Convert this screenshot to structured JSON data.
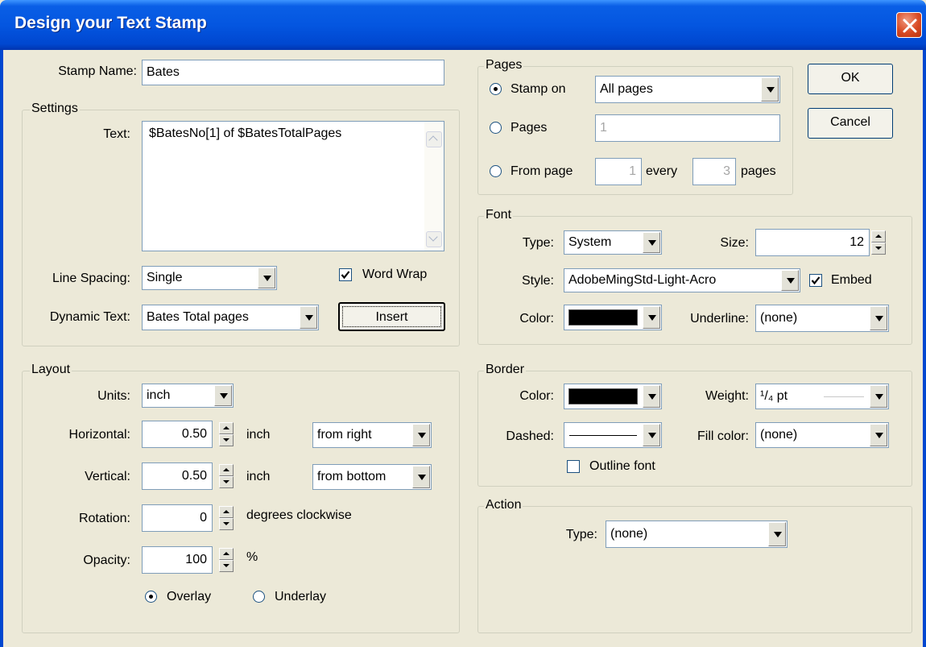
{
  "window": {
    "title": "Design your Text Stamp"
  },
  "stamp_name": {
    "label": "Stamp Name:",
    "value": "Bates"
  },
  "settings": {
    "legend": "Settings",
    "text_label": "Text:",
    "text_value": "$BatesNo[1] of $BatesTotalPages",
    "line_spacing_label": "Line Spacing:",
    "line_spacing_value": "Single",
    "word_wrap_label": "Word Wrap",
    "word_wrap_checked": true,
    "dynamic_text_label": "Dynamic Text:",
    "dynamic_text_value": "Bates Total pages",
    "insert_label": "Insert"
  },
  "layout": {
    "legend": "Layout",
    "units_label": "Units:",
    "units_value": "inch",
    "horizontal_label": "Horizontal:",
    "horizontal_value": "0.50",
    "horizontal_unit": "inch",
    "horizontal_from": "from right",
    "vertical_label": "Vertical:",
    "vertical_value": "0.50",
    "vertical_unit": "inch",
    "vertical_from": "from bottom",
    "rotation_label": "Rotation:",
    "rotation_value": "0",
    "rotation_unit": "degrees clockwise",
    "opacity_label": "Opacity:",
    "opacity_value": "100",
    "opacity_unit": "%",
    "overlay_label": "Overlay",
    "underlay_label": "Underlay",
    "selected_mode": "Overlay"
  },
  "pages": {
    "legend": "Pages",
    "stamp_on_label": "Stamp on",
    "stamp_on_value": "All pages",
    "pages_label": "Pages",
    "pages_value": "1",
    "from_page_label": "From page",
    "from_page_value": "1",
    "every_label": "every",
    "every_value": "3",
    "pages_suffix": "pages",
    "selected": "Stamp on"
  },
  "buttons": {
    "ok": "OK",
    "cancel": "Cancel"
  },
  "font": {
    "legend": "Font",
    "type_label": "Type:",
    "type_value": "System",
    "size_label": "Size:",
    "size_value": "12",
    "style_label": "Style:",
    "style_value": "AdobeMingStd-Light-Acro",
    "embed_label": "Embed",
    "embed_checked": true,
    "color_label": "Color:",
    "color_value": "#000000",
    "underline_label": "Underline:",
    "underline_value": "(none)"
  },
  "border": {
    "legend": "Border",
    "color_label": "Color:",
    "color_value": "#000000",
    "weight_label": "Weight:",
    "weight_value": "¹/₄ pt",
    "dashed_label": "Dashed:",
    "fill_color_label": "Fill color:",
    "fill_color_value": "(none)",
    "outline_font_label": "Outline font",
    "outline_font_checked": false
  },
  "action": {
    "legend": "Action",
    "type_label": "Type:",
    "type_value": "(none)"
  }
}
